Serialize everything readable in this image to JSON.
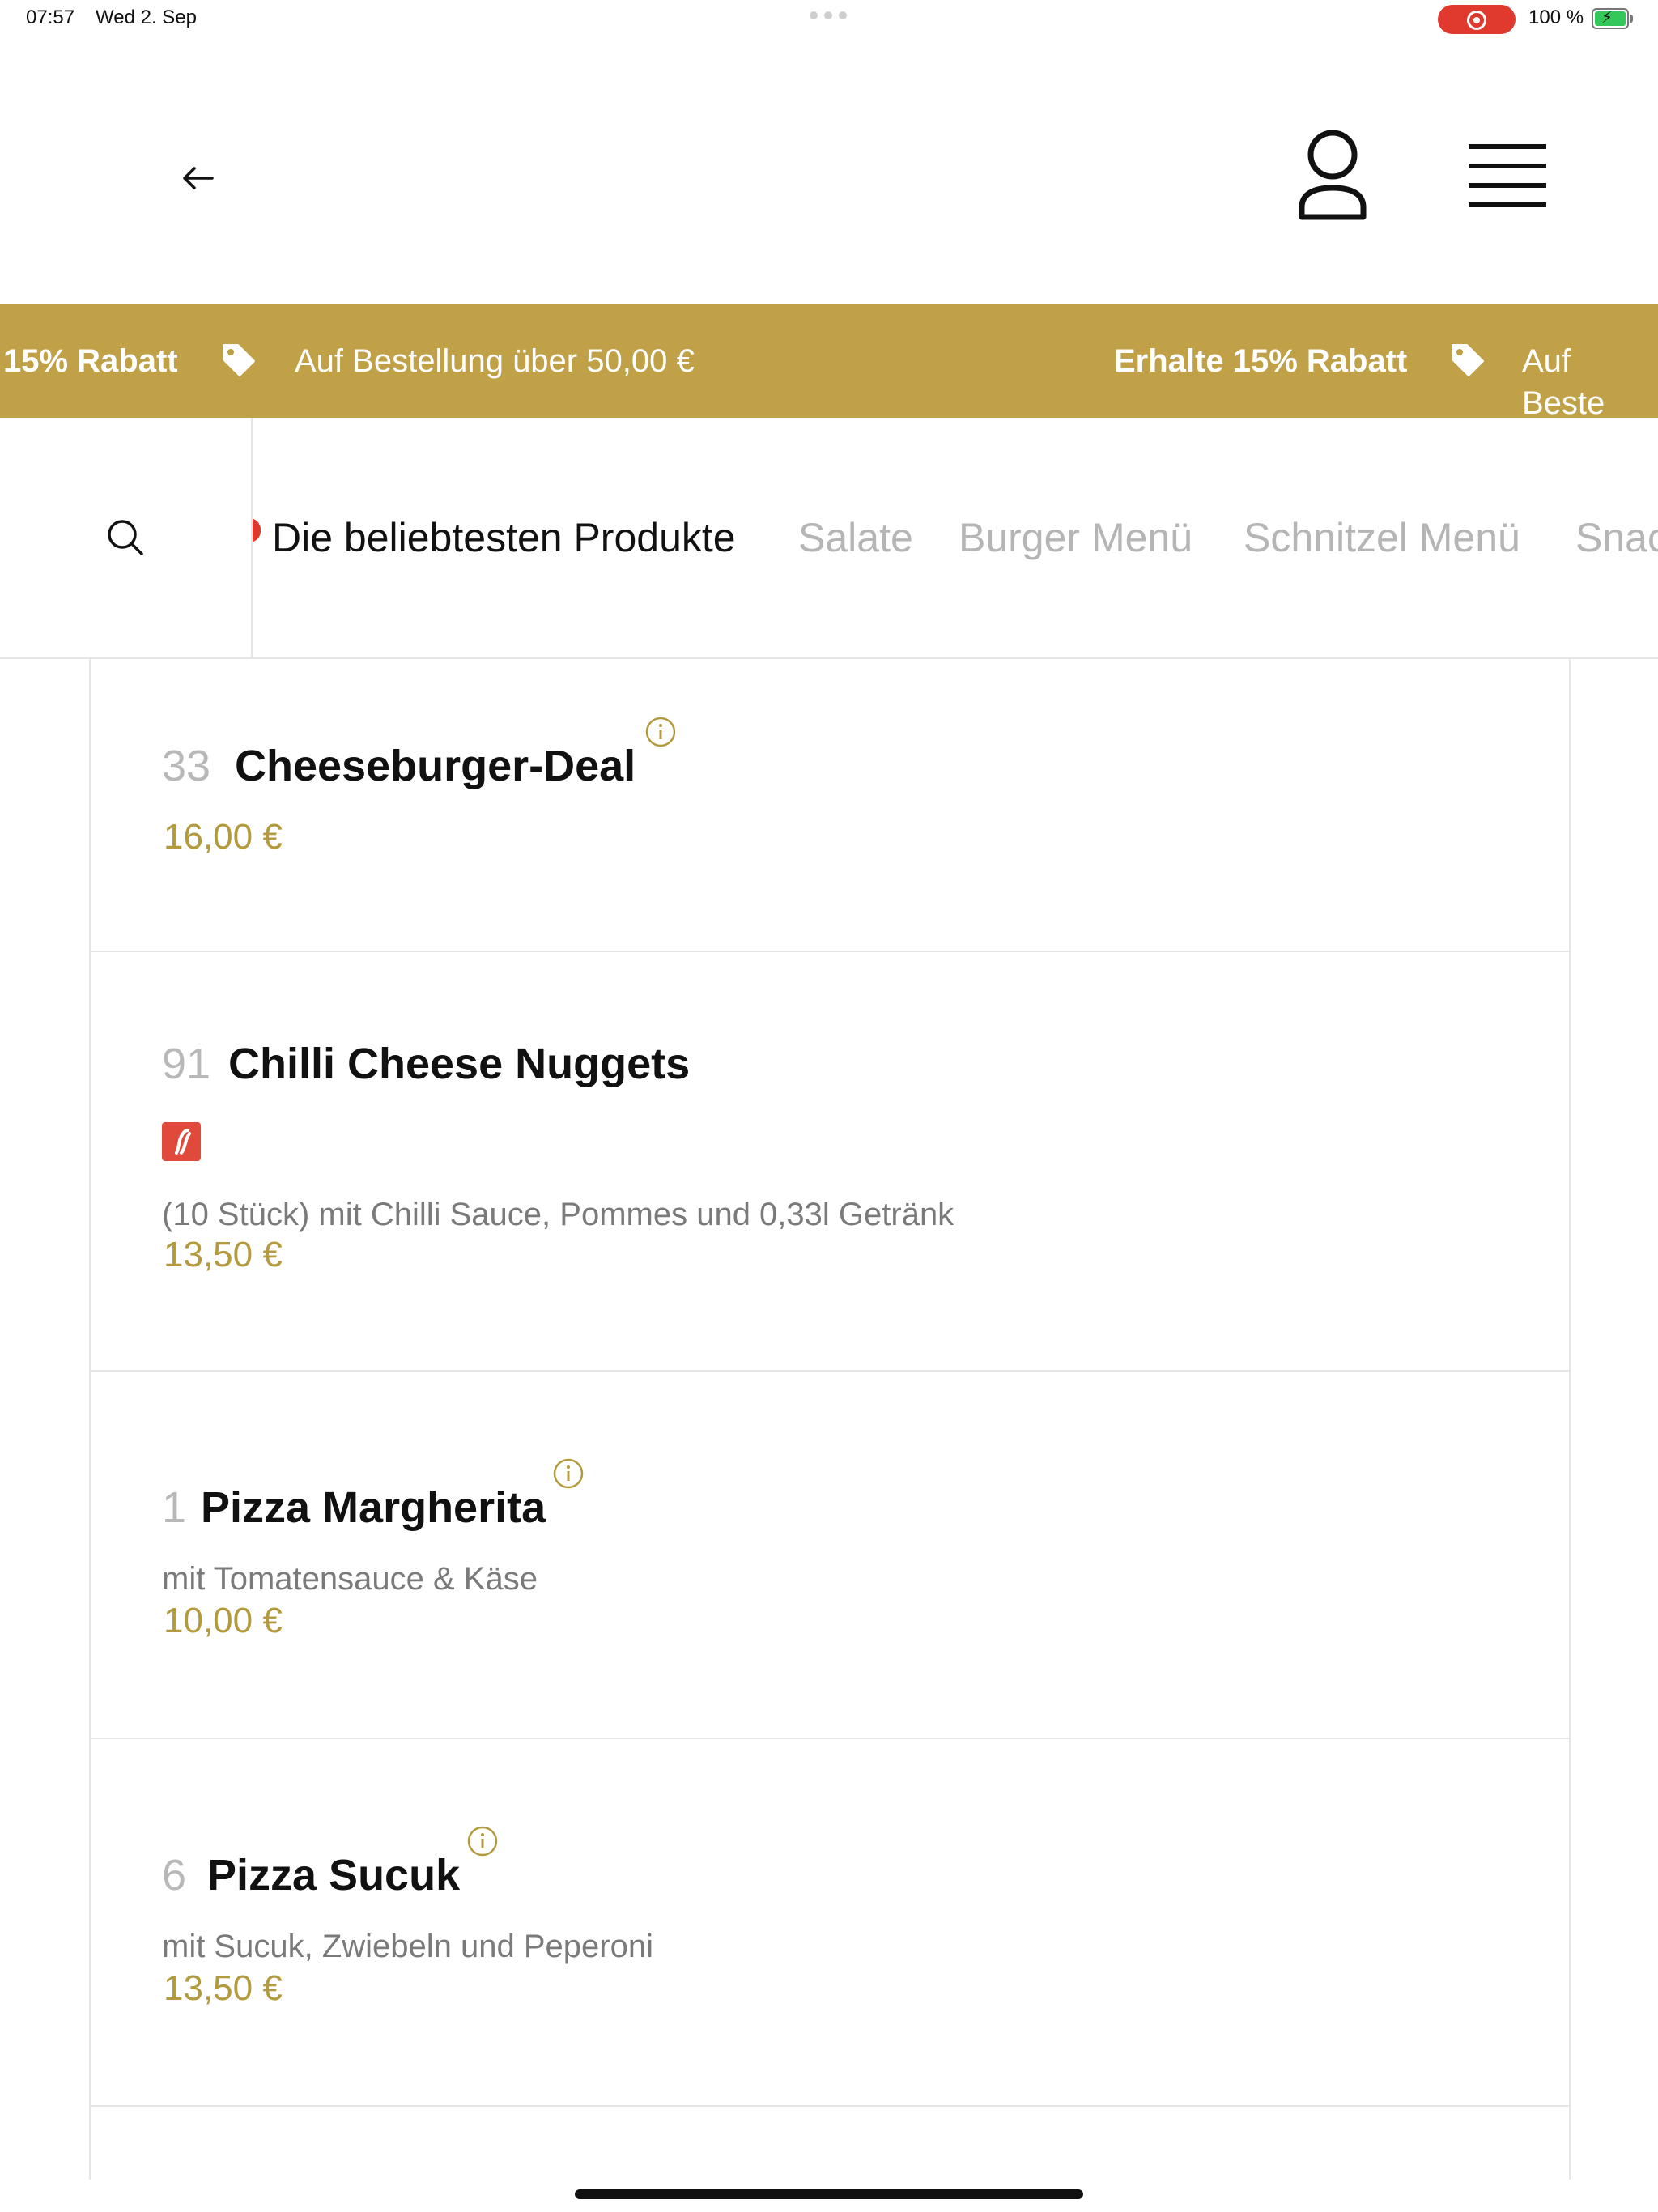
{
  "status_bar": {
    "time": "07:57",
    "date": "Wed 2. Sep",
    "battery": "100 %",
    "battery_level": 1.0,
    "colors": {
      "recording": "#e03a2f",
      "battery_fill": "#34c759"
    }
  },
  "header": {
    "back_icon": "arrow-left-icon",
    "account_icon": "user-icon",
    "menu_icon": "hamburger-menu-icon"
  },
  "promo_banner": {
    "background": "#c0a147",
    "items": [
      {
        "strong": "15% Rabatt",
        "text": "Auf Bestellung über 50,00 €"
      },
      {
        "strong": "Erhalte 15% Rabatt",
        "text": "Auf Beste"
      }
    ],
    "icon": "tag-icon"
  },
  "category_nav": {
    "search_icon": "search-icon",
    "categories": [
      {
        "label": "Die beliebtesten Produkte",
        "active": true
      },
      {
        "label": "Salate",
        "active": false
      },
      {
        "label": "Burger Menü",
        "active": false
      },
      {
        "label": "Schnitzel Menü",
        "active": false
      },
      {
        "label": "Snac",
        "active": false
      }
    ]
  },
  "products": [
    {
      "number": "33",
      "name": "Cheeseburger-Deal",
      "description": "",
      "price": "16,00 €",
      "has_info": true,
      "spicy": false
    },
    {
      "number": "91",
      "name": "Chilli Cheese Nuggets",
      "description": "(10 Stück) mit Chilli Sauce, Pommes und 0,33l Getränk",
      "price": "13,50 €",
      "has_info": false,
      "spicy": true
    },
    {
      "number": "1",
      "name": "Pizza Margherita",
      "description": "mit Tomatensauce & Käse",
      "price": "10,00 €",
      "has_info": true,
      "spicy": false
    },
    {
      "number": "6",
      "name": "Pizza Sucuk",
      "description": "mit Sucuk, Zwiebeln und Peperoni",
      "price": "13,50 €",
      "has_info": true,
      "spicy": false
    }
  ],
  "colors": {
    "accent_gold": "#c0a147",
    "price_gold": "#b49a3e",
    "active_dot": "#e0362c",
    "chili_badge": "#e04a3b"
  }
}
